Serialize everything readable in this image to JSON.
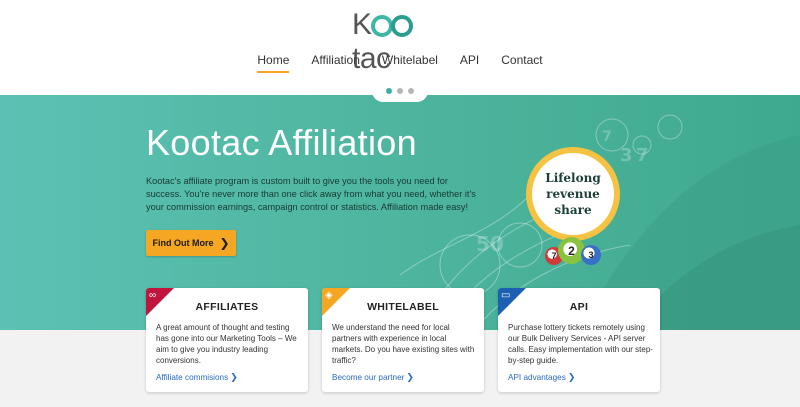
{
  "logo": {
    "text_prefix": "K",
    "text_suffix": "tac"
  },
  "nav": {
    "items": [
      {
        "label": "Home",
        "active": true
      },
      {
        "label": "Affiliation",
        "active": false
      },
      {
        "label": "Whitelabel",
        "active": false
      },
      {
        "label": "API",
        "active": false
      },
      {
        "label": "Contact",
        "active": false
      }
    ]
  },
  "slider": {
    "slide_count": 3,
    "active_slide": 1
  },
  "hero": {
    "title": "Kootac Affiliation",
    "text": "Kootac's affiliate program is custom built to give you the tools you need for success. You're never more than one click away from what you need, whether it's your commission earnings, campaign control or statistics. Affiliation made easy!",
    "cta_label": "Find Out More",
    "badge_line1": "Lifelong",
    "badge_line2": "revenue",
    "badge_line3": "share",
    "balls": [
      "7",
      "2",
      "3"
    ]
  },
  "cards": [
    {
      "title": "AFFILIATES",
      "desc": "A great amount of thought and testing has gone into our Marketing Tools – We aim to give you industry leading conversions.",
      "link": "Affiliate commisions",
      "icon": "link-icon",
      "color": "#c0163d"
    },
    {
      "title": "WHITELABEL",
      "desc": "We understand the need for local partners with experience in local markets. Do you have existing sites with traffic?",
      "link": "Become our partner",
      "icon": "tag-icon",
      "color": "#f5a623"
    },
    {
      "title": "API",
      "desc": "Purchase lottery tickets remotely using our Bulk Delivery Services - API server calls. Easy implementation with our step-by-step guide.",
      "link": "API advantages",
      "icon": "monitor-icon",
      "color": "#1d5fb3"
    }
  ],
  "colors": {
    "accent": "#f5a623",
    "hero_teal": "#4cb49c",
    "link": "#2a6ac0"
  }
}
